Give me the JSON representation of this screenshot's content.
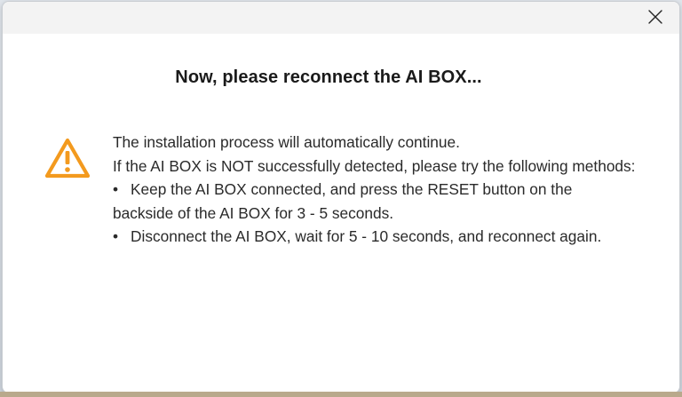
{
  "dialog": {
    "close_label": "",
    "heading": "Now, please reconnect the AI BOX...",
    "icon": "warning-triangle-icon",
    "icon_color": "#f39a1e",
    "lines": {
      "line1": "The installation process will automatically continue.",
      "line2": "If the AI BOX is NOT successfully detected, please try the following methods:",
      "bullet_char": "•",
      "bullet1": "Keep the AI BOX connected, and press the RESET button on the backside of the AI BOX for 3 - 5 seconds.",
      "bullet2": "Disconnect the AI BOX, wait for 5 - 10 seconds, and reconnect again."
    }
  }
}
